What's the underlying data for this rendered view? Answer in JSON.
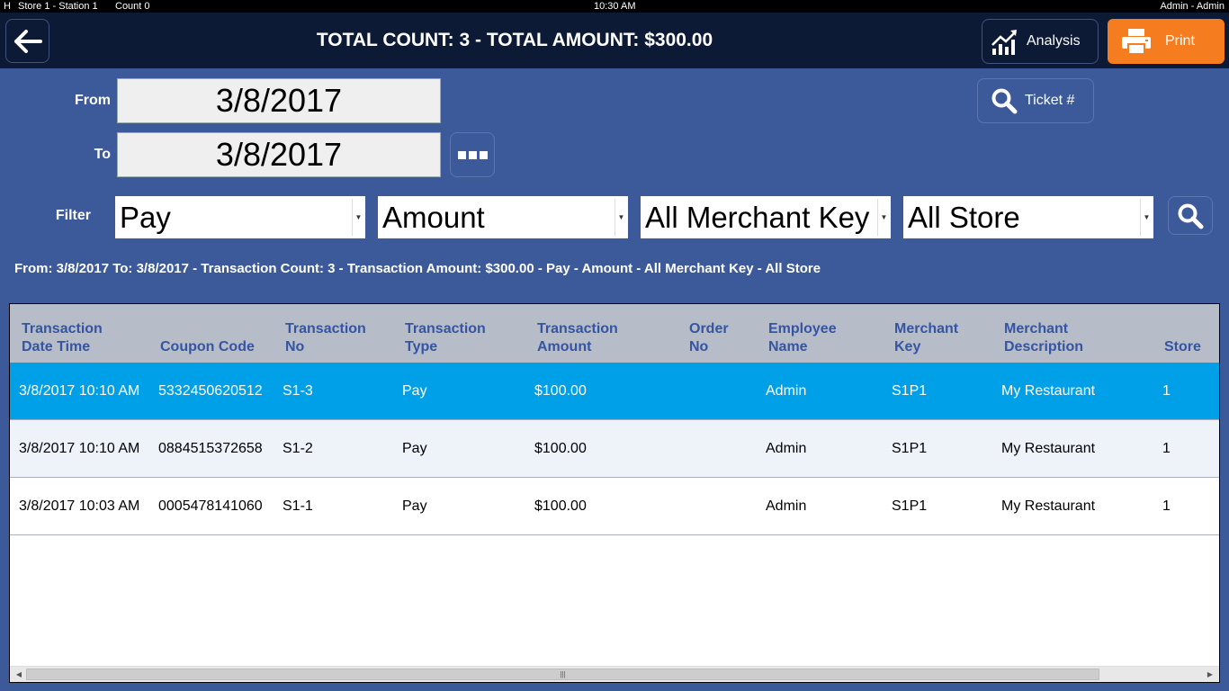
{
  "statusbar": {
    "h": "H",
    "store_station": "Store 1 - Station 1",
    "count": "Count 0",
    "time": "10:30 AM",
    "user": "Admin - Admin"
  },
  "header": {
    "title": "TOTAL COUNT: 3 - TOTAL AMOUNT: $300.00",
    "analysis_label": "Analysis",
    "print_label": "Print"
  },
  "dates": {
    "from_label": "From",
    "to_label": "To",
    "from_value": "3/8/2017",
    "to_value": "3/8/2017"
  },
  "ticket_label": "Ticket #",
  "filter": {
    "label": "Filter",
    "type": "Pay",
    "amount": "Amount",
    "merchant_key": "All Merchant Key",
    "store": "All Store"
  },
  "summary": "From: 3/8/2017 To: 3/8/2017 - Transaction Count: 3 - Transaction Amount: $300.00 - Pay - Amount - All Merchant Key - All Store",
  "table": {
    "headers": [
      {
        "l1": "Transaction",
        "l2": "Date Time"
      },
      {
        "l1": "",
        "l2": "Coupon Code"
      },
      {
        "l1": "Transaction",
        "l2": "No"
      },
      {
        "l1": "Transaction",
        "l2": "Type"
      },
      {
        "l1": "Transaction",
        "l2": "Amount"
      },
      {
        "l1": "Order",
        "l2": "No"
      },
      {
        "l1": "Employee",
        "l2": "Name"
      },
      {
        "l1": "Merchant",
        "l2": "Key"
      },
      {
        "l1": "Merchant",
        "l2": "Description"
      },
      {
        "l1": "",
        "l2": "Store"
      }
    ],
    "rows": [
      [
        "3/8/2017 10:10 AM",
        "5332450620512",
        "S1-3",
        "Pay",
        "$100.00",
        "",
        "Admin",
        "S1P1",
        "My Restaurant",
        "1"
      ],
      [
        "3/8/2017 10:10 AM",
        "0884515372658",
        "S1-2",
        "Pay",
        "$100.00",
        "",
        "Admin",
        "S1P1",
        "My Restaurant",
        "1"
      ],
      [
        "3/8/2017 10:03 AM",
        "0005478141060",
        "S1-1",
        "Pay",
        "$100.00",
        "",
        "Admin",
        "S1P1",
        "My Restaurant",
        "1"
      ]
    ]
  },
  "colors": {
    "background": "#3c5a9a",
    "header": "#0c1a36",
    "print": "#f57d1f",
    "selected_row": "#00a0e8",
    "table_header_text": "#3555a2"
  },
  "icons": [
    "back-arrow-icon",
    "analysis-chart-icon",
    "printer-icon",
    "search-icon",
    "ellipsis-icon"
  ]
}
